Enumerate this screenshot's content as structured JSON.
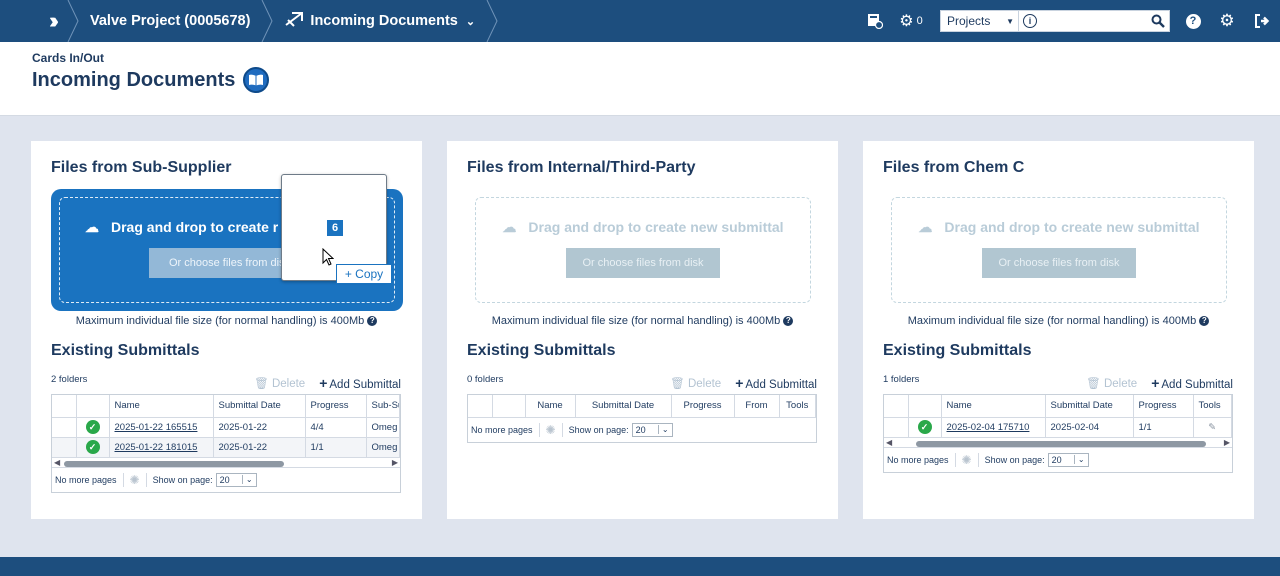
{
  "topbar": {
    "project": "Valve Project (0005678)",
    "section": "Incoming Documents",
    "counter": "0",
    "search_scope": "Projects",
    "search_placeholder": ""
  },
  "header": {
    "subtitle": "Cards In/Out",
    "title": "Incoming Documents"
  },
  "cards": [
    {
      "title": "Files from Sub-Supplier",
      "drop_text": "Drag and drop to create r",
      "choose_label": "Or choose files from dis",
      "max_size": "Maximum individual file size (for normal handling) is 400Mb",
      "existing_title": "Existing Submittals",
      "folders": "2 folders",
      "delete_label": "Delete",
      "add_label": "Add Submittal",
      "columns": [
        "",
        "",
        "Name",
        "Submittal Date",
        "Progress",
        "Sub-Su"
      ],
      "rows": [
        {
          "name": "2025-01-22 165515",
          "date": "2025-01-22",
          "progress": "4/4",
          "extra": "Omeg"
        },
        {
          "name": "2025-01-22 181015",
          "date": "2025-01-22",
          "progress": "1/1",
          "extra": "Omeg"
        }
      ],
      "pager_text": "No more pages",
      "show_label": "Show on page:",
      "page_size": "20"
    },
    {
      "title": "Files from Internal/Third-Party",
      "drop_text": "Drag and drop to create new submittal",
      "choose_label": "Or choose files from disk",
      "max_size": "Maximum individual file size (for normal handling) is 400Mb",
      "existing_title": "Existing Submittals",
      "folders": "0 folders",
      "delete_label": "Delete",
      "add_label": "Add Submittal",
      "columns": [
        "",
        "",
        "Name",
        "Submittal Date",
        "Progress",
        "From",
        "Tools"
      ],
      "pager_text": "No more pages",
      "show_label": "Show on page:",
      "page_size": "20"
    },
    {
      "title": "Files from Chem C",
      "drop_text": "Drag and drop to create new submittal",
      "choose_label": "Or choose files from disk",
      "max_size": "Maximum individual file size (for normal handling) is 400Mb",
      "existing_title": "Existing Submittals",
      "folders": "1 folders",
      "delete_label": "Delete",
      "add_label": "Add Submittal",
      "columns": [
        "",
        "",
        "Name",
        "Submittal Date",
        "Progress",
        "Tools"
      ],
      "rows": [
        {
          "name": "2025-02-04 175710",
          "date": "2025-02-04",
          "progress": "1/1"
        }
      ],
      "pager_text": "No more pages",
      "show_label": "Show on page:",
      "page_size": "20"
    }
  ],
  "drag": {
    "count": "6",
    "copy_label": "+ Copy"
  }
}
